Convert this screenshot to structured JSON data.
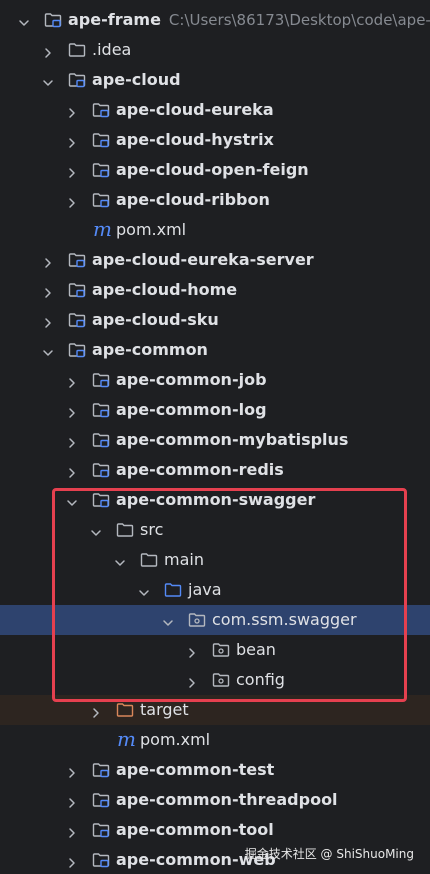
{
  "project_tree": {
    "root": {
      "label": "ape-frame",
      "path": "C:\\Users\\86173\\Desktop\\code\\ape-f"
    },
    "rows": [
      {
        "label": "ape-frame",
        "depth": 0,
        "kind": "module",
        "state": "open",
        "bold": true
      },
      {
        "label": ".idea",
        "depth": 1,
        "kind": "folder",
        "state": "closed",
        "bold": false
      },
      {
        "label": "ape-cloud",
        "depth": 1,
        "kind": "module",
        "state": "open",
        "bold": true
      },
      {
        "label": "ape-cloud-eureka",
        "depth": 2,
        "kind": "module",
        "state": "closed",
        "bold": true
      },
      {
        "label": "ape-cloud-hystrix",
        "depth": 2,
        "kind": "module",
        "state": "closed",
        "bold": true
      },
      {
        "label": "ape-cloud-open-feign",
        "depth": 2,
        "kind": "module",
        "state": "closed",
        "bold": true
      },
      {
        "label": "ape-cloud-ribbon",
        "depth": 2,
        "kind": "module",
        "state": "closed",
        "bold": true
      },
      {
        "label": "pom.xml",
        "depth": 2,
        "kind": "maven",
        "state": "none",
        "bold": false
      },
      {
        "label": "ape-cloud-eureka-server",
        "depth": 1,
        "kind": "module",
        "state": "closed",
        "bold": true
      },
      {
        "label": "ape-cloud-home",
        "depth": 1,
        "kind": "module",
        "state": "closed",
        "bold": true
      },
      {
        "label": "ape-cloud-sku",
        "depth": 1,
        "kind": "module",
        "state": "closed",
        "bold": true
      },
      {
        "label": "ape-common",
        "depth": 1,
        "kind": "module",
        "state": "open",
        "bold": true
      },
      {
        "label": "ape-common-job",
        "depth": 2,
        "kind": "module",
        "state": "closed",
        "bold": true
      },
      {
        "label": "ape-common-log",
        "depth": 2,
        "kind": "module",
        "state": "closed",
        "bold": true
      },
      {
        "label": "ape-common-mybatisplus",
        "depth": 2,
        "kind": "module",
        "state": "closed",
        "bold": true
      },
      {
        "label": "ape-common-redis",
        "depth": 2,
        "kind": "module",
        "state": "closed",
        "bold": true
      },
      {
        "label": "ape-common-swagger",
        "depth": 2,
        "kind": "module",
        "state": "open",
        "bold": true
      },
      {
        "label": "src",
        "depth": 3,
        "kind": "folder",
        "state": "open",
        "bold": false
      },
      {
        "label": "main",
        "depth": 4,
        "kind": "folder",
        "state": "open",
        "bold": false
      },
      {
        "label": "java",
        "depth": 5,
        "kind": "source",
        "state": "open",
        "bold": false
      },
      {
        "label": "com.ssm.swagger",
        "depth": 6,
        "kind": "package",
        "state": "open",
        "bold": false,
        "selected": true
      },
      {
        "label": "bean",
        "depth": 7,
        "kind": "package",
        "state": "closed",
        "bold": false
      },
      {
        "label": "config",
        "depth": 7,
        "kind": "package",
        "state": "closed",
        "bold": false
      },
      {
        "label": "target",
        "depth": 3,
        "kind": "excluded",
        "state": "closed",
        "bold": false,
        "excluded": true
      },
      {
        "label": "pom.xml",
        "depth": 3,
        "kind": "maven",
        "state": "none",
        "bold": false
      },
      {
        "label": "ape-common-test",
        "depth": 2,
        "kind": "module",
        "state": "closed",
        "bold": true
      },
      {
        "label": "ape-common-threadpool",
        "depth": 2,
        "kind": "module",
        "state": "closed",
        "bold": true
      },
      {
        "label": "ape-common-tool",
        "depth": 2,
        "kind": "module",
        "state": "closed",
        "bold": true
      },
      {
        "label": "ape-common-web",
        "depth": 2,
        "kind": "module",
        "state": "closed",
        "bold": true
      }
    ]
  },
  "icons": {
    "module": "module-folder-icon",
    "folder": "folder-icon",
    "source": "source-root-icon",
    "package": "package-icon",
    "excluded": "excluded-folder-icon",
    "maven": "maven-pom-icon"
  },
  "colors": {
    "background": "#1e1f22",
    "selection": "#2e436e",
    "excluded_row": "#2d2520",
    "highlight_border": "#e5404f",
    "source_root": "#548af7",
    "excluded_folder": "#d9875a",
    "module_badge": "#548af7"
  },
  "watermark": "掘金技术社区 @ ShiShuoMing"
}
